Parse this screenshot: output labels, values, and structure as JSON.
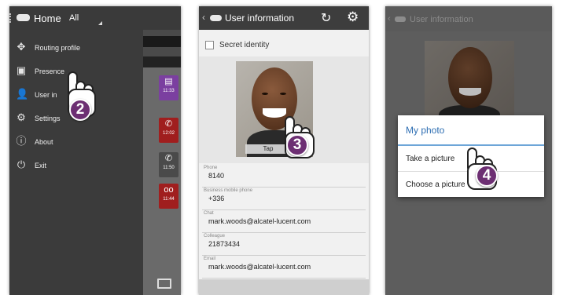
{
  "panel1": {
    "title": "Home",
    "subtitle": "All",
    "menu": [
      {
        "label": "Routing profile",
        "icon": "routing-icon",
        "glyph": "✥"
      },
      {
        "label": "Presence",
        "icon": "presence-icon",
        "glyph": "▣"
      },
      {
        "label": "User in",
        "icon": "user-icon",
        "glyph": "👤"
      },
      {
        "label": "Settings",
        "icon": "gear-icon",
        "glyph": "⚙"
      },
      {
        "label": "About",
        "icon": "info-icon",
        "glyph": "ⓘ"
      },
      {
        "label": "Exit",
        "icon": "exit-icon",
        "glyph": "⏻"
      }
    ],
    "tiles": [
      {
        "time": "11:33",
        "color": "#7b3fa0",
        "glyph": "▤"
      },
      {
        "time": "12:02",
        "color": "#a01e1e",
        "glyph": "✆"
      },
      {
        "time": "11:50",
        "color": "#4a4a4a",
        "glyph": "✆"
      },
      {
        "time": "11:44",
        "color": "#a01e1e",
        "glyph": "oo"
      }
    ],
    "step": "2"
  },
  "panel2": {
    "title": "User information",
    "secret_label": "Secret identity",
    "tap_label": "Tap",
    "step": "3",
    "fields": [
      {
        "label": "Phone",
        "value": "8140"
      },
      {
        "label": "Business mobile phone",
        "value": "+336"
      },
      {
        "label": "Chat",
        "value": "mark.woods@alcatel-lucent.com"
      },
      {
        "label": "Colleague",
        "value": "21873434"
      },
      {
        "label": "Email",
        "value": "mark.woods@alcatel-lucent.com"
      }
    ]
  },
  "panel3": {
    "title": "User information",
    "dialog_title": "My photo",
    "option_take": "Take a picture",
    "option_choose": "Choose a picture",
    "step": "4"
  },
  "colors": {
    "accent_purple": "#6d2f73",
    "dialog_blue": "#2f6fb3"
  }
}
